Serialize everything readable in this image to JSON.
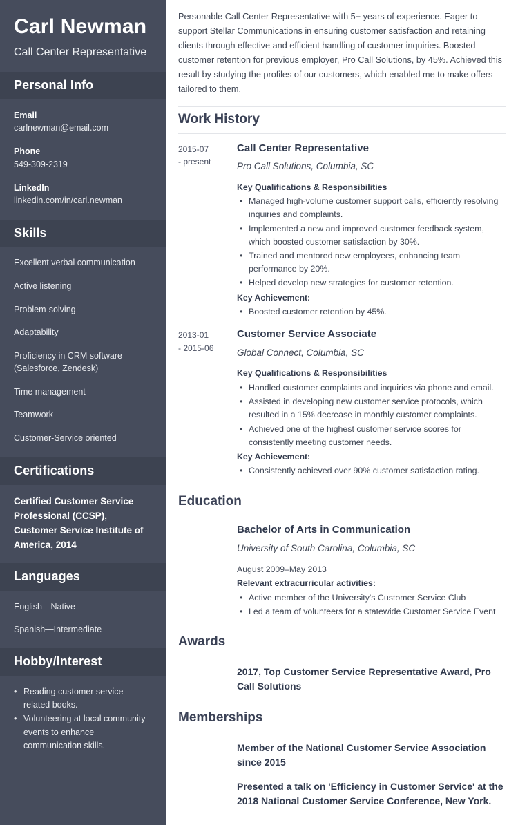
{
  "sidebar": {
    "full_name": "Carl Newman",
    "job_title": "Call Center Representative",
    "personal_info": {
      "heading": "Personal Info",
      "fields": [
        {
          "label": "Email",
          "value": "carlnewman@email.com"
        },
        {
          "label": "Phone",
          "value": "549-309-2319"
        },
        {
          "label": "LinkedIn",
          "value": "linkedin.com/in/carl.newman"
        }
      ]
    },
    "skills": {
      "heading": "Skills",
      "items": [
        "Excellent verbal communication",
        "Active listening",
        "Problem-solving",
        "Adaptability",
        "Proficiency in CRM software (Salesforce, Zendesk)",
        "Time management",
        "Teamwork",
        "Customer-Service oriented"
      ]
    },
    "certifications": {
      "heading": "Certifications",
      "items": [
        "Certified Customer Service Professional (CCSP), Customer Service Institute of America, 2014"
      ]
    },
    "languages": {
      "heading": "Languages",
      "items": [
        "English—Native",
        "Spanish—Intermediate"
      ]
    },
    "hobby": {
      "heading": "Hobby/Interest",
      "items": [
        "Reading customer service-related books.",
        "Volunteering at local community events to enhance communication skills."
      ]
    }
  },
  "main": {
    "summary": "Personable Call Center Representative with 5+ years of experience. Eager to support Stellar Communications in ensuring customer satisfaction and retaining clients through effective and efficient handling of customer inquiries. Boosted customer retention for previous employer, Pro Call Solutions, by 45%. Achieved this result by studying the profiles of our customers, which enabled me to make offers tailored to them.",
    "work_history": {
      "heading": "Work History",
      "entries": [
        {
          "date_start": "2015-07",
          "date_end": "- present",
          "role": "Call Center Representative",
          "organization": "Pro Call Solutions, Columbia, SC",
          "qualifications_label": "Key Qualifications & Responsibilities",
          "qualifications": [
            "Managed high-volume customer support calls, efficiently resolving inquiries and complaints.",
            "Implemented a new and improved customer feedback system, which boosted customer satisfaction by 30%.",
            "Trained and mentored new employees, enhancing team performance by 20%.",
            "Helped develop new strategies for customer retention."
          ],
          "achievement_label": "Key Achievement:",
          "achievements": [
            "Boosted customer retention by 45%."
          ]
        },
        {
          "date_start": "2013-01",
          "date_end": "- 2015-06",
          "role": "Customer Service Associate",
          "organization": "Global Connect, Columbia, SC",
          "qualifications_label": "Key Qualifications & Responsibilities",
          "qualifications": [
            "Handled customer complaints and inquiries via phone and email.",
            "Assisted in developing new customer service protocols, which resulted in a 15% decrease in monthly customer complaints.",
            "Achieved one of the highest customer service scores for consistently meeting customer needs."
          ],
          "achievement_label": "Key Achievement:",
          "achievements": [
            "Consistently achieved over 90% customer satisfaction rating."
          ]
        }
      ]
    },
    "education": {
      "heading": "Education",
      "entries": [
        {
          "degree": "Bachelor of Arts in Communication",
          "institution": "University of South Carolina, Columbia, SC",
          "dates": "August 2009–May 2013",
          "activities_label": "Relevant extracurricular activities:",
          "activities": [
            "Active member of the University's Customer Service Club",
            "Led a team of volunteers for a statewide Customer Service Event"
          ]
        }
      ]
    },
    "awards": {
      "heading": "Awards",
      "entries": [
        "2017, Top Customer Service Representative Award, Pro Call Solutions"
      ]
    },
    "memberships": {
      "heading": "Memberships",
      "entries": [
        "Member of the National Customer Service Association since 2015",
        "Presented a talk on 'Efficiency in Customer Service' at the 2018 National Customer Service Conference, New York."
      ]
    }
  }
}
